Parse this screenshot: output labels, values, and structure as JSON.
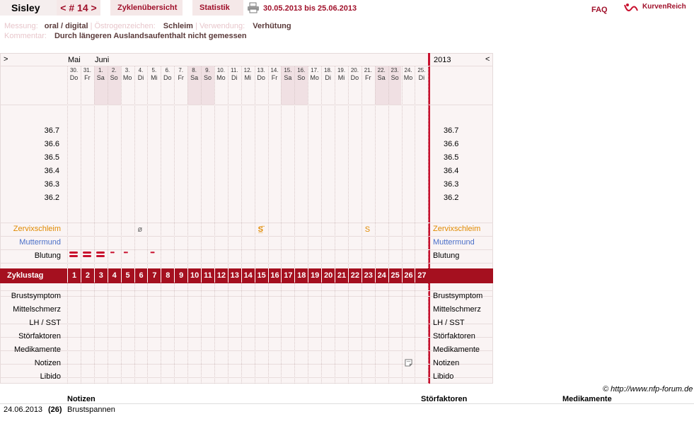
{
  "header": {
    "title": "Sisley",
    "cycle_nav": "< # 14 >",
    "tab_overview": "Zyklenübersicht",
    "tab_stats": "Statistik",
    "date_range": "30.05.2013 bis 25.06.2013",
    "faq": "FAQ",
    "brand": "KurvenReich"
  },
  "meta": {
    "line1": [
      {
        "label": "Messung:",
        "value": "oral / digital"
      },
      {
        "label": "Östrogenzeichen:",
        "value": "Schleim"
      },
      {
        "label": "Verwendung:",
        "value": "Verhütung"
      }
    ],
    "line2_label": "Kommentar:",
    "line2_value": "Durch längeren Auslandsaufenthalt nicht gemessen"
  },
  "chart": {
    "nav_left": ">",
    "nav_right": "<",
    "month_may": "Mai",
    "month_june": "Juni",
    "year": "2013",
    "days": [
      {
        "d": "30.",
        "w": "Do",
        "we": false
      },
      {
        "d": "31.",
        "w": "Fr",
        "we": false
      },
      {
        "d": "1.",
        "w": "Sa",
        "we": true
      },
      {
        "d": "2.",
        "w": "So",
        "we": true
      },
      {
        "d": "3.",
        "w": "Mo",
        "we": false
      },
      {
        "d": "4.",
        "w": "Di",
        "we": false
      },
      {
        "d": "5.",
        "w": "Mi",
        "we": false
      },
      {
        "d": "6.",
        "w": "Do",
        "we": false
      },
      {
        "d": "7.",
        "w": "Fr",
        "we": false
      },
      {
        "d": "8.",
        "w": "Sa",
        "we": true
      },
      {
        "d": "9.",
        "w": "So",
        "we": true
      },
      {
        "d": "10.",
        "w": "Mo",
        "we": false
      },
      {
        "d": "11.",
        "w": "Di",
        "we": false
      },
      {
        "d": "12.",
        "w": "Mi",
        "we": false
      },
      {
        "d": "13.",
        "w": "Do",
        "we": false
      },
      {
        "d": "14.",
        "w": "Fr",
        "we": false
      },
      {
        "d": "15.",
        "w": "Sa",
        "we": true
      },
      {
        "d": "16.",
        "w": "So",
        "we": true
      },
      {
        "d": "17.",
        "w": "Mo",
        "we": false
      },
      {
        "d": "18.",
        "w": "Di",
        "we": false
      },
      {
        "d": "19.",
        "w": "Mi",
        "we": false
      },
      {
        "d": "20.",
        "w": "Do",
        "we": false
      },
      {
        "d": "21.",
        "w": "Fr",
        "we": false
      },
      {
        "d": "22.",
        "w": "Sa",
        "we": true
      },
      {
        "d": "23.",
        "w": "So",
        "we": true
      },
      {
        "d": "24.",
        "w": "Mo",
        "we": false
      },
      {
        "d": "25.",
        "w": "Di",
        "we": false
      }
    ],
    "temps": [
      "36.7",
      "36.6",
      "36.5",
      "36.4",
      "36.3",
      "36.2"
    ],
    "row_labels": {
      "mucus": "Zervixschleim",
      "cervix": "Muttermund",
      "bleeding": "Blutung",
      "cycle_day": "Zyklustag",
      "breast": "Brustsymptom",
      "midpain": "Mittelschmerz",
      "lh": "LH / SST",
      "disturb": "Störfaktoren",
      "meds": "Medikamente",
      "notes": "Notizen",
      "libido": "Libido"
    },
    "cycle_days": [
      "1",
      "2",
      "3",
      "4",
      "5",
      "6",
      "7",
      "8",
      "9",
      "10",
      "11",
      "12",
      "13",
      "14",
      "15",
      "16",
      "17",
      "18",
      "19",
      "20",
      "21",
      "22",
      "23",
      "24",
      "25",
      "26",
      "27"
    ],
    "bleeding": [
      {
        "day": 1,
        "type": "heavy"
      },
      {
        "day": 2,
        "type": "heavy"
      },
      {
        "day": 3,
        "type": "heavy"
      },
      {
        "day": 4,
        "type": "light"
      },
      {
        "day": 5,
        "type": "light"
      },
      {
        "day": 7,
        "type": "light"
      }
    ],
    "bleeding_light_symbol": "•••",
    "mucus_marks": [
      {
        "day": 6,
        "symbol": "ø",
        "color": "#666666"
      },
      {
        "day": 15,
        "symbol": "S̲̈",
        "color": "#e08a00"
      },
      {
        "day": 23,
        "symbol": "S",
        "color": "#e08a00"
      }
    ],
    "colors": {
      "accent": "#a0102a",
      "mucus": "#e08a00",
      "cervix": "#4a6fc8",
      "cycleBar": "#a5101f",
      "weekend": "#f0e0e3"
    }
  },
  "credit": "© http://www.nfp-forum.de",
  "footer": {
    "headers": {
      "notes": "Notizen",
      "disturb": "Störfaktoren",
      "meds": "Medikamente"
    },
    "entries": [
      {
        "date": "24.06.2013",
        "day": "(26)",
        "note": "Brustspannen"
      }
    ]
  }
}
